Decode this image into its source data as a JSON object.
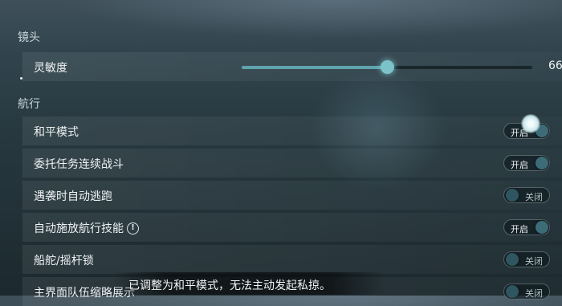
{
  "sections": {
    "camera_title": "镜头",
    "voyage_title": "航行"
  },
  "sensitivity": {
    "label": "灵敏度",
    "value": "66",
    "level_fraction": 0.5
  },
  "rows": [
    {
      "label": "和平模式",
      "state": "开启",
      "on": true
    },
    {
      "label": "委托任务连续战斗",
      "state": "开启",
      "on": true
    },
    {
      "label": "遇袭时自动逃跑",
      "state": "关闭",
      "on": false
    },
    {
      "label": "自动施放航行技能",
      "state": "开启",
      "on": true
    },
    {
      "label": "船舵/摇杆锁",
      "state": "关闭",
      "on": false
    },
    {
      "label": "主界面队伍缩略展示",
      "state": "关闭",
      "on": false
    }
  ],
  "toast": {
    "message": "已调整为和平模式，无法主动发起私掠。"
  },
  "colors": {
    "accent": "#5fa3ad",
    "thumb": "#7bc3c9"
  },
  "icons": {
    "info": "info-circle-icon"
  }
}
